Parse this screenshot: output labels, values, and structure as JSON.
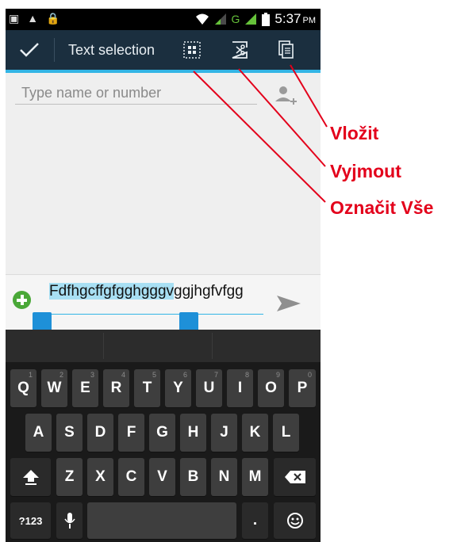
{
  "status_bar": {
    "time": "5:37",
    "ampm": "PM",
    "left_icons": [
      "gallery-notification-icon",
      "warning-icon",
      "lock-icon"
    ],
    "right_icons": [
      "wifi-icon",
      "signal-icon-1",
      "signal-icon-2",
      "battery-icon"
    ]
  },
  "action_bar": {
    "title": "Text selection",
    "done_icon": "checkmark-icon",
    "select_all_icon": "select-all-icon",
    "cut_icon": "cut-icon",
    "paste_icon": "paste-icon"
  },
  "recipient": {
    "placeholder": "Type name or number"
  },
  "message": {
    "selected_text": "Fdfhgcffgfgghgggv",
    "rest_text": "ggjhgfvfgg"
  },
  "keyboard": {
    "row1": [
      {
        "label": "Q",
        "num": "1"
      },
      {
        "label": "W",
        "num": "2"
      },
      {
        "label": "E",
        "num": "3"
      },
      {
        "label": "R",
        "num": "4"
      },
      {
        "label": "T",
        "num": "5"
      },
      {
        "label": "Y",
        "num": "6"
      },
      {
        "label": "U",
        "num": "7"
      },
      {
        "label": "I",
        "num": "8"
      },
      {
        "label": "O",
        "num": "9"
      },
      {
        "label": "P",
        "num": "0"
      }
    ],
    "row2": [
      "A",
      "S",
      "D",
      "F",
      "G",
      "H",
      "J",
      "K",
      "L"
    ],
    "row3": [
      "Z",
      "X",
      "C",
      "V",
      "B",
      "N",
      "M"
    ],
    "sym_label": "?123",
    "period_label": "."
  },
  "annotations": {
    "paste": "Vložit",
    "cut": "Vyjmout",
    "select_all": "Označit Vše",
    "color": "#e3001b"
  },
  "colors": {
    "accent": "#33b5e5",
    "action_bar": "#1b2f3f",
    "selection": "#a8dff3"
  }
}
